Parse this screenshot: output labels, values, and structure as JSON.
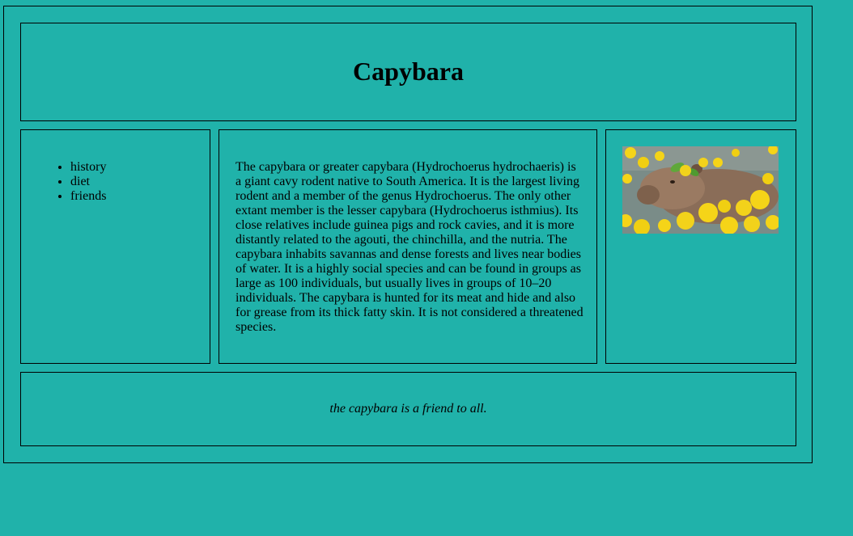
{
  "header": {
    "title": "Capybara"
  },
  "nav": {
    "items": [
      "history",
      "diet",
      "friends"
    ]
  },
  "content": {
    "paragraph": "The capybara or greater capybara (Hydrochoerus hydrochaeris) is a giant cavy rodent native to South America. It is the largest living rodent and a member of the genus Hydrochoerus. The only other extant member is the lesser capybara (Hydrochoerus isthmius). Its close relatives include guinea pigs and rock cavies, and it is more distantly related to the agouti, the chinchilla, and the nutria. The capybara inhabits savannas and dense forests and lives near bodies of water. It is a highly social species and can be found in groups as large as 100 individuals, but usually lives in groups of 10–20 individuals. The capybara is hunted for its meat and hide and also for grease from its thick fatty skin. It is not considered a threatened species."
  },
  "aside": {
    "image": "capybara-in-yuzu-bath"
  },
  "footer": {
    "text": "the capybara is a friend to all."
  },
  "colors": {
    "background": "#20b2aa",
    "border": "#000000"
  }
}
